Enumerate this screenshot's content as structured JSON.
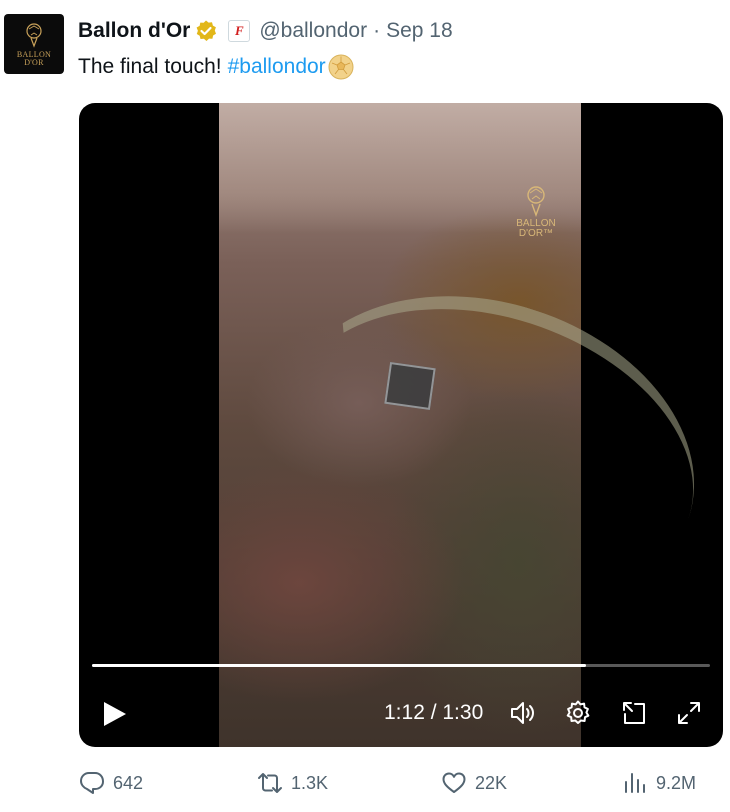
{
  "author": {
    "display_name": "Ballon d'Or",
    "handle": "@ballondor",
    "separator": "·",
    "date": "Sep 18",
    "avatar_text": "BALLON\nD'OR",
    "affiliate_badge": "F",
    "verified_icon": "verified-gold-badge-icon"
  },
  "tweet": {
    "text": "The final touch!",
    "hashtag": "#ballondor",
    "emoji": "soccer-ball-gold-emoji"
  },
  "video": {
    "watermark_text": "BALLON\nD'OR™",
    "current_time": "1:12",
    "duration": "1:30",
    "time_label": "1:12 / 1:30",
    "progress_fraction": 0.8,
    "icons": [
      "play-icon",
      "volume-icon",
      "settings-gear-icon",
      "dock-icon",
      "fullscreen-icon"
    ]
  },
  "actions": {
    "replies": "642",
    "retweets": "1.3K",
    "likes": "22K",
    "views": "9.2M"
  },
  "colors": {
    "link": "#1d9bf0",
    "muted": "#536471",
    "gold": "#c9a25a",
    "verified_gold": "#e2b719"
  }
}
